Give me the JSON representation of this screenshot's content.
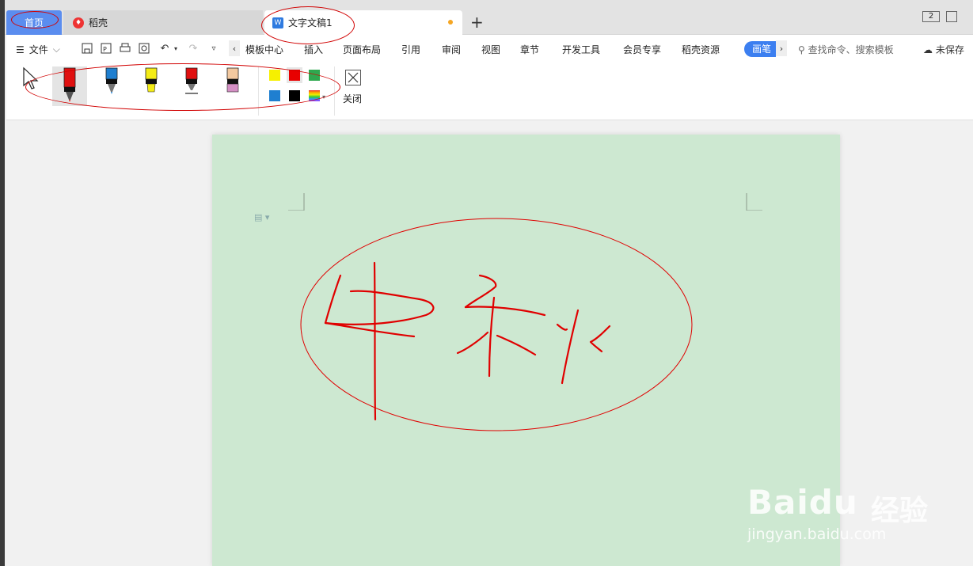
{
  "tabs": {
    "home": "首页",
    "docer": "稻壳",
    "document": "文字文稿1",
    "window_badge": "2"
  },
  "menu": {
    "file": "文件",
    "ribbon_tabs": [
      "模板中心",
      "插入",
      "页面布局",
      "引用",
      "审阅",
      "视图",
      "章节",
      "开发工具",
      "会员专享",
      "稻壳资源"
    ],
    "pen_tab": "画笔",
    "search_placeholder": "查找命令、搜索模板",
    "save_status": "未保存"
  },
  "pen_tools": [
    {
      "name": "red-marker",
      "color": "#e01010",
      "selected": true
    },
    {
      "name": "blue-marker",
      "color": "#1f7fd0",
      "selected": false
    },
    {
      "name": "yellow-highlighter",
      "color": "#f4ec16",
      "selected": false
    },
    {
      "name": "red-pen",
      "color": "#e01010",
      "selected": false
    },
    {
      "name": "eraser",
      "color": "#f3c9a0",
      "selected": false
    }
  ],
  "colors": [
    {
      "name": "yellow",
      "hex": "#f6f000"
    },
    {
      "name": "red",
      "hex": "#e80000",
      "selected": true
    },
    {
      "name": "green",
      "hex": "#2fa84f"
    },
    {
      "name": "blue",
      "hex": "#1f7fd0"
    },
    {
      "name": "black",
      "hex": "#000000"
    },
    {
      "name": "custom",
      "hex": "rainbow"
    }
  ],
  "close_label": "关闭",
  "watermark": {
    "main": "Baidu",
    "cn": "经验",
    "sub": "jingyan.baidu.com"
  },
  "accent": "#3c7ff0",
  "page_color": "#cde8d1",
  "ink_color": "#e00000"
}
